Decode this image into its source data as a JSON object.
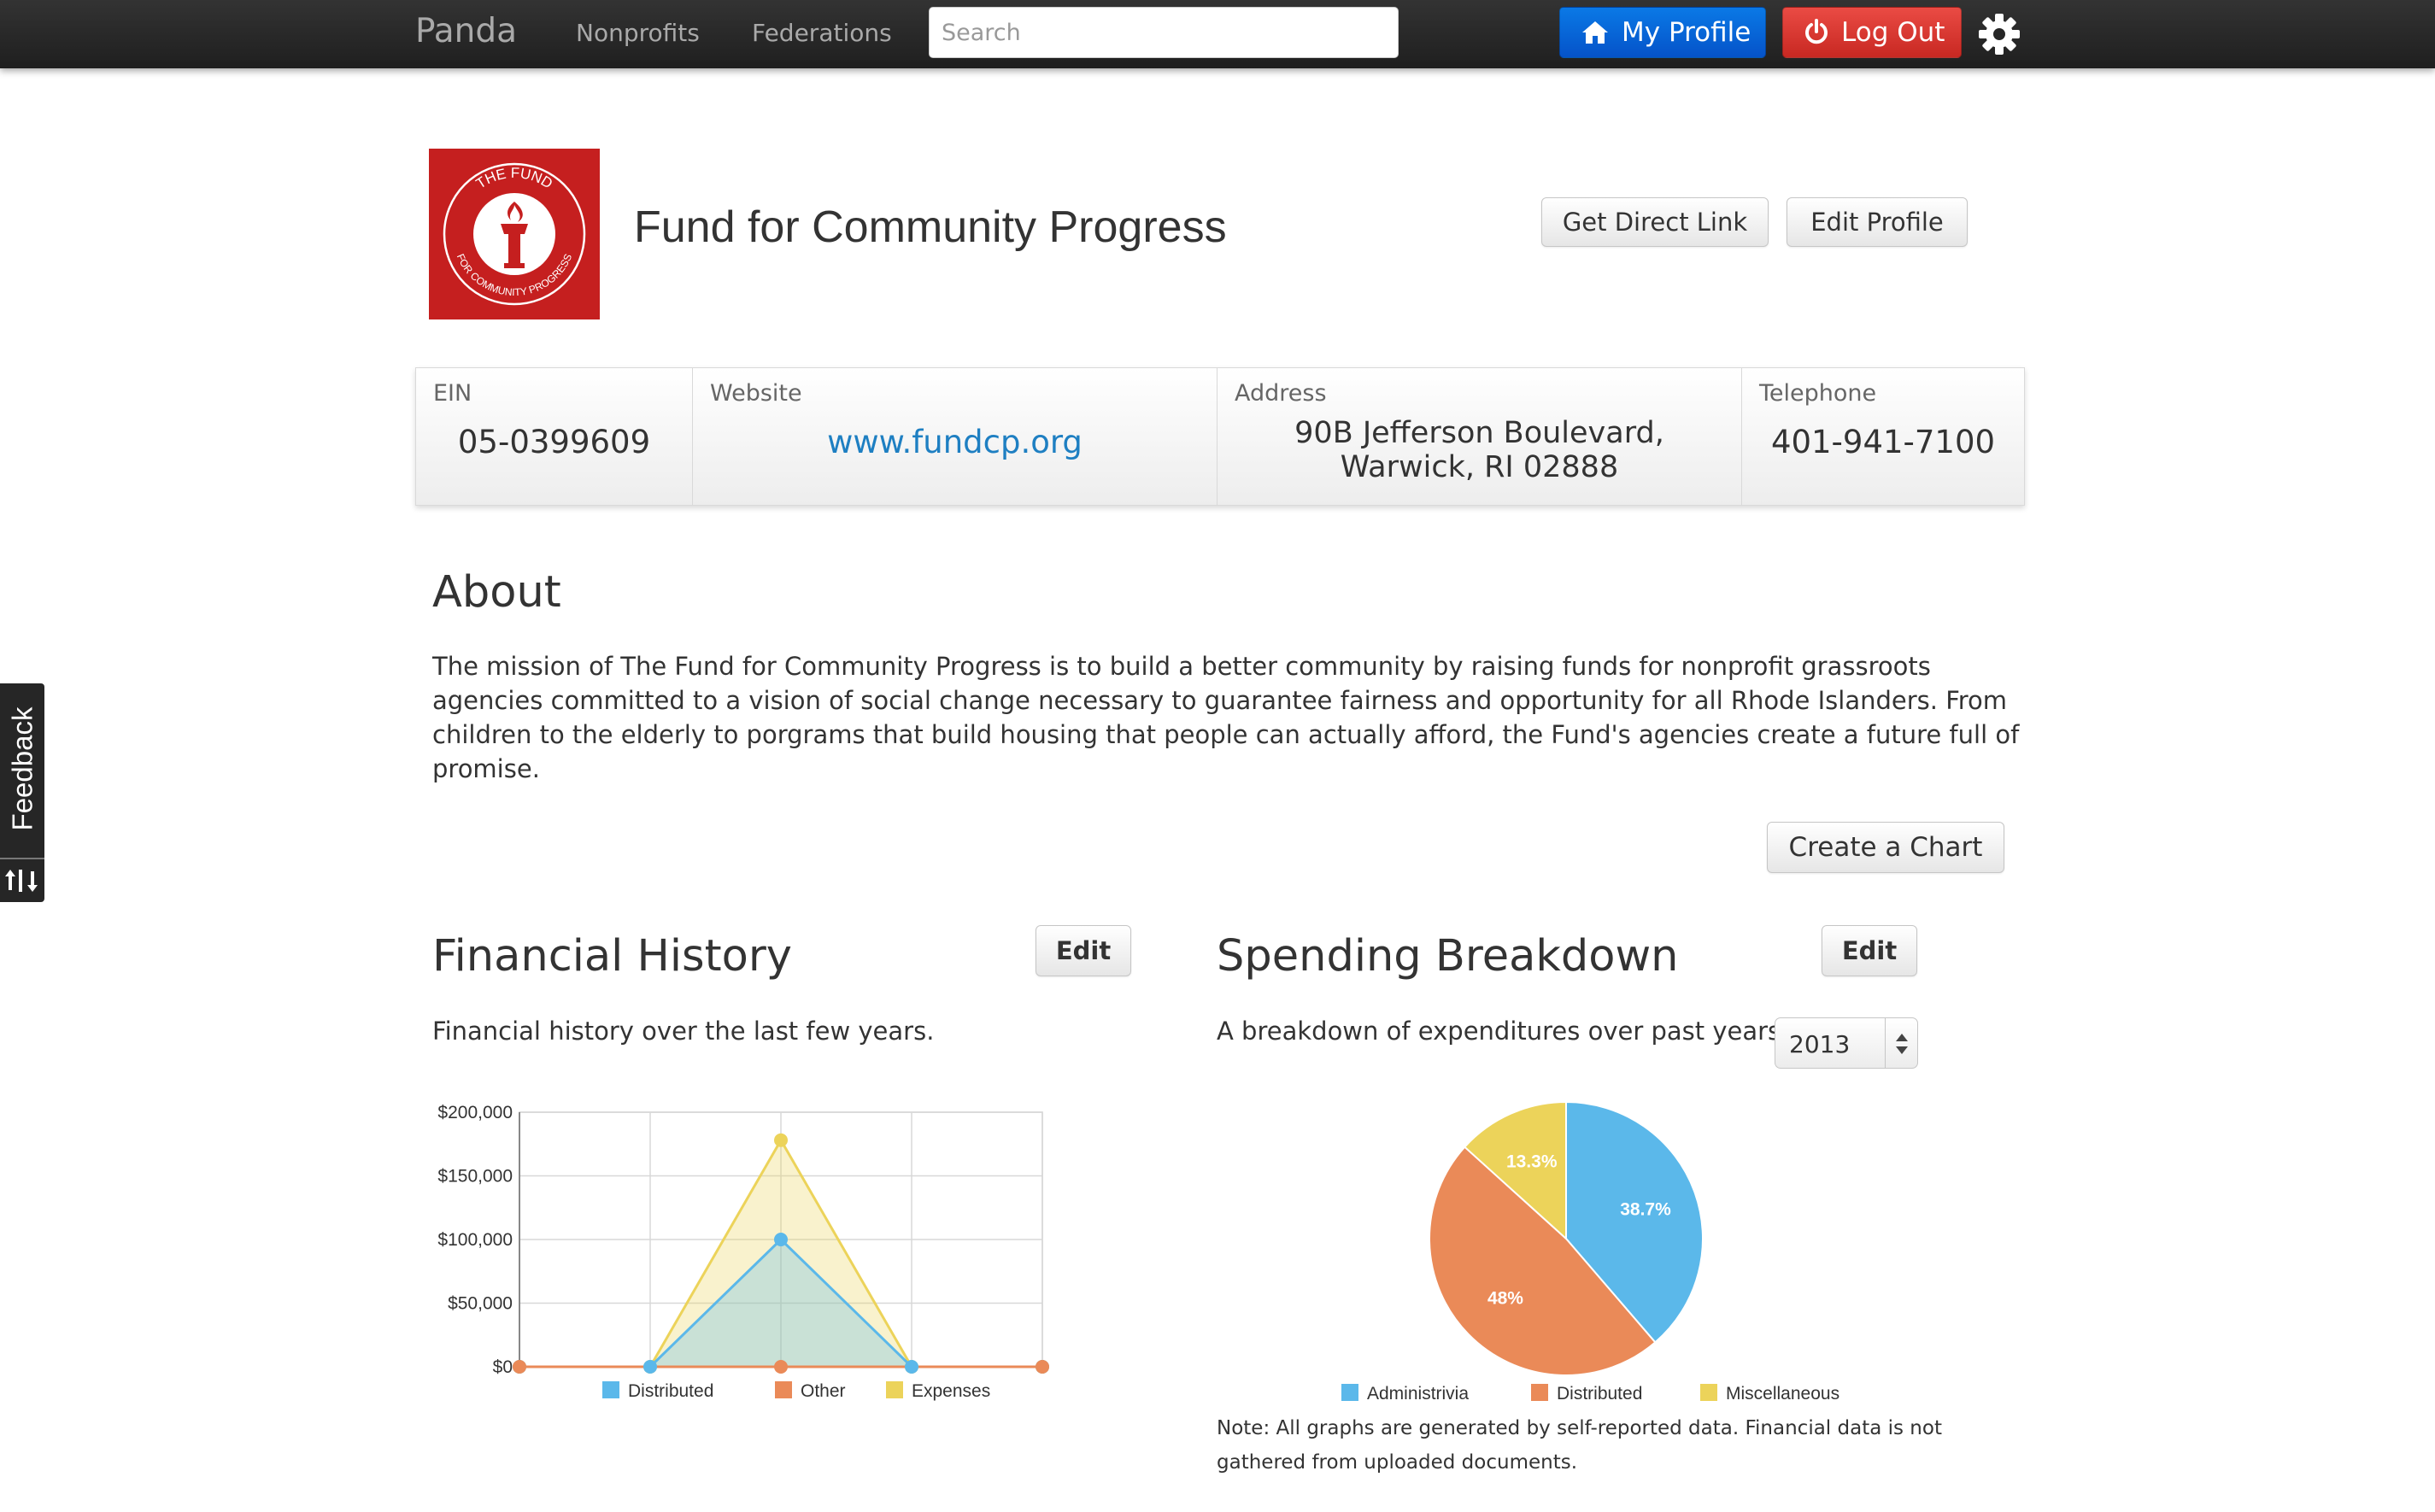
{
  "navbar": {
    "brand": "Panda",
    "links": [
      "Nonprofits",
      "Federations"
    ],
    "search_placeholder": "Search",
    "my_profile_label": "My Profile",
    "logout_label": "Log Out",
    "profile_button_color": "#0663d8",
    "logout_button_color": "#dc3a34"
  },
  "org": {
    "name": "Fund for Community Progress",
    "logo_color": "#c51f1f",
    "logo_text_top": "THE FUND",
    "logo_text_bottom": "FOR COMMUNITY PROGRESS",
    "get_direct_link_label": "Get Direct Link",
    "edit_profile_label": "Edit Profile"
  },
  "info": {
    "ein_label": "EIN",
    "ein": "05-0399609",
    "website_label": "Website",
    "website": "www.fundcp.org",
    "address_label": "Address",
    "address_line1": "90B Jefferson Boulevard,",
    "address_line2": "Warwick, RI 02888",
    "telephone_label": "Telephone",
    "telephone": "401-941-7100"
  },
  "about": {
    "title": "About",
    "text": "The mission of The Fund for Community Progress is to build a better community by raising funds for nonprofit grassroots agencies committed to a vision of social change necessary to guarantee fairness and opportunity for all Rhode Islanders. From children to the elderly to porgrams that build housing that people can actually afford, the Fund's agencies create a future full of promise."
  },
  "create_chart_label": "Create a Chart",
  "financial_history": {
    "title": "Financial History",
    "edit_label": "Edit",
    "description": "Financial history over the last few years."
  },
  "spending_breakdown": {
    "title": "Spending Breakdown",
    "edit_label": "Edit",
    "description": "A breakdown of expenditures over past years.",
    "year_selected": "2013"
  },
  "note": "Note: All graphs are generated by self-reported data. Financial data is not gathered from uploaded documents.",
  "feedback_label": "Feedback",
  "chart_data": [
    {
      "type": "area",
      "x": [
        0,
        1,
        2,
        3,
        4
      ],
      "ylim": [
        0,
        200000
      ],
      "yticks": [
        "$200,000",
        "$150,000",
        "$100,000",
        "$50,000",
        "$0"
      ],
      "tick_values": [
        200000,
        150000,
        100000,
        50000,
        0
      ],
      "grid": true,
      "legend": "bottom",
      "series": [
        {
          "name": "Distributed",
          "color": "#5bb8ea",
          "values": [
            0,
            0,
            100000,
            0,
            0
          ]
        },
        {
          "name": "Other",
          "color": "#ea8a58",
          "values": [
            0,
            0,
            0,
            0,
            0
          ]
        },
        {
          "name": "Expenses",
          "color": "#ecd35a",
          "values": [
            0,
            0,
            178000,
            0,
            0
          ]
        }
      ]
    },
    {
      "type": "pie",
      "legend": "bottom",
      "slices": [
        {
          "name": "Administrivia",
          "value": 38.7,
          "label": "38.7%",
          "color": "#5bb8ea"
        },
        {
          "name": "Distributed",
          "value": 48,
          "label": "48%",
          "color": "#ea8a58"
        },
        {
          "name": "Miscellaneous",
          "value": 13.3,
          "label": "13.3%",
          "color": "#ecd35a"
        }
      ]
    }
  ]
}
